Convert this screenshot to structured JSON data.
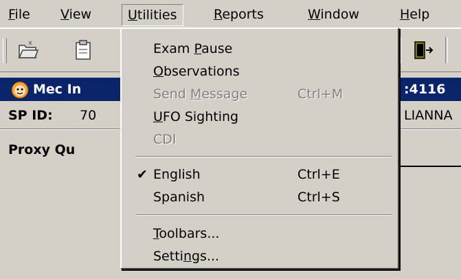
{
  "menubar": {
    "items": [
      {
        "label": "File",
        "mnemonic": "F",
        "rest": "ile"
      },
      {
        "label": "View",
        "mnemonic": "V",
        "rest": "iew"
      },
      {
        "label": "Utilities",
        "mnemonic": "U",
        "rest": "tilities"
      },
      {
        "label": "Reports",
        "mnemonic": "R",
        "rest": "eports"
      },
      {
        "label": "Window",
        "mnemonic": "W",
        "rest": "indow"
      },
      {
        "label": "Help",
        "mnemonic": "H",
        "rest": "elp"
      }
    ]
  },
  "toolbar": {
    "icons": [
      "folder-open-icon",
      "clipboard-icon",
      "exit-door-icon"
    ]
  },
  "caption": {
    "title_left": "Mec In",
    "title_right": ":4116"
  },
  "info": {
    "sp_label": "SP ID:",
    "sp_value": "70",
    "name_fragment": "LIANNA"
  },
  "proxy": {
    "label": "Proxy Qu"
  },
  "utilities_menu": {
    "items": [
      {
        "pre": "Exam ",
        "mn": "P",
        "post": "ause",
        "shortcut": "",
        "disabled": false,
        "checked": false
      },
      {
        "pre": "",
        "mn": "O",
        "post": "bservations",
        "shortcut": "",
        "disabled": false,
        "checked": false
      },
      {
        "pre": "Send ",
        "mn": "M",
        "post": "essage",
        "shortcut": "Ctrl+M",
        "disabled": true,
        "checked": false
      },
      {
        "pre": "",
        "mn": "U",
        "post": "FO Sighting",
        "shortcut": "",
        "disabled": false,
        "checked": false
      },
      {
        "pre": "CDI",
        "mn": "",
        "post": "",
        "shortcut": "",
        "disabled": true,
        "checked": false
      },
      {
        "pre": "English",
        "mn": "",
        "post": "",
        "shortcut": "Ctrl+E",
        "disabled": false,
        "checked": true
      },
      {
        "pre": "Spanish",
        "mn": "",
        "post": "",
        "shortcut": "Ctrl+S",
        "disabled": false,
        "checked": false
      },
      {
        "pre": "",
        "mn": "T",
        "post": "oolbars...",
        "shortcut": "",
        "disabled": false,
        "checked": false
      },
      {
        "pre": "Setti",
        "mn": "n",
        "post": "gs...",
        "shortcut": "",
        "disabled": false,
        "checked": false
      }
    ],
    "check_glyph": "✔"
  },
  "colors": {
    "face": "#d4d0c8",
    "caption": "#0a246a",
    "disabled_text": "#808080"
  }
}
